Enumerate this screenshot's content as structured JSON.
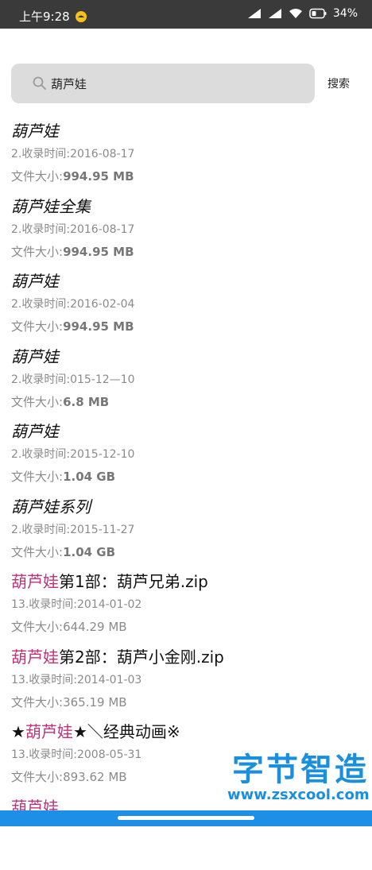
{
  "status_bar": {
    "time": "上午9:28",
    "battery": "34%"
  },
  "search": {
    "query": "葫芦娃",
    "button_label": "搜索"
  },
  "results": [
    {
      "title_highlight": "葫芦娃",
      "title_rest": "",
      "time": "2.收录时间:2016-08-17",
      "size_label": "文件大小:",
      "size_value": "994.95 MB",
      "italic": true
    },
    {
      "title_highlight": "葫芦娃全集",
      "title_rest": "",
      "time": "2.收录时间:2016-08-17",
      "size_label": "文件大小:",
      "size_value": "994.95 MB",
      "italic": true
    },
    {
      "title_highlight": "葫芦娃",
      "title_rest": "",
      "time": "2.收录时间:2016-02-04",
      "size_label": "文件大小:",
      "size_value": "994.95 MB",
      "italic": true
    },
    {
      "title_highlight": "葫芦娃",
      "title_rest": "",
      "time": "2.收录时间:015-12—10",
      "size_label": "文件大小:",
      "size_value": "6.8 MB",
      "italic": true
    },
    {
      "title_highlight": "葫芦娃",
      "title_rest": "",
      "time": "2.收录时间:2015-12-10",
      "size_label": "文件大小:",
      "size_value": "1.04 GB",
      "italic": true
    },
    {
      "title_highlight": "葫芦娃系列",
      "title_rest": "",
      "time": "2.收录时间:2015-11-27",
      "size_label": "文件大小:",
      "size_value": "1.04 GB",
      "italic": true
    },
    {
      "title_prefix": "",
      "title_highlight": "葫芦娃",
      "title_rest": "第1部：葫芦兄弟.zip",
      "time": "13.收录时间:2014-01-02",
      "size_label": "文件大小:",
      "size_value": "644.29 MB",
      "italic": false
    },
    {
      "title_prefix": "",
      "title_highlight": "葫芦娃",
      "title_rest": "第2部：葫芦小金刚.zip",
      "time": "13.收录时间:2014-01-03",
      "size_label": "文件大小:",
      "size_value": "365.19 MB",
      "italic": false
    },
    {
      "title_prefix": "★",
      "title_highlight": "葫芦娃",
      "title_rest": "★＼经典动画※",
      "time": "13.收录时间:2008-05-31",
      "size_label": "文件大小:",
      "size_value": "893.62 MB",
      "italic": false
    },
    {
      "title_prefix": "",
      "title_highlight": "葫芦娃",
      "title_rest": "",
      "time": "",
      "size_label": "",
      "size_value": "",
      "italic": false
    }
  ],
  "watermark": {
    "title": "字节智造",
    "url": "www.zsxcool.com"
  },
  "colors": {
    "highlight": "#c2307a",
    "watermark": "#1a8fe0",
    "nav_bar": "#1e8fe6"
  }
}
